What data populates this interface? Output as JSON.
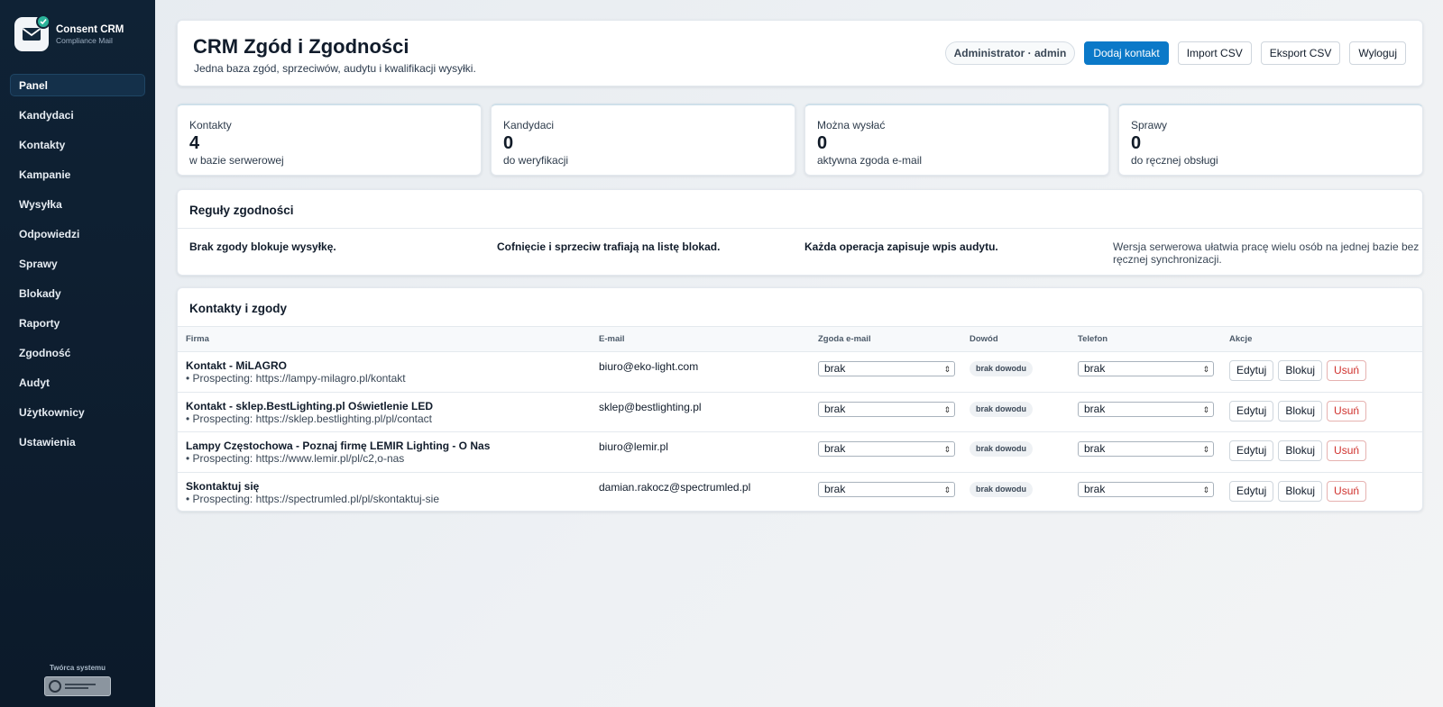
{
  "brand": {
    "title": "Consent CRM",
    "subtitle": "Compliance Mail"
  },
  "sidebar": {
    "items": [
      {
        "label": "Panel",
        "active": true
      },
      {
        "label": "Kandydaci"
      },
      {
        "label": "Kontakty"
      },
      {
        "label": "Kampanie"
      },
      {
        "label": "Wysyłka"
      },
      {
        "label": "Odpowiedzi"
      },
      {
        "label": "Sprawy"
      },
      {
        "label": "Blokady"
      },
      {
        "label": "Raporty"
      },
      {
        "label": "Zgodność"
      },
      {
        "label": "Audyt"
      },
      {
        "label": "Użytkownicy"
      },
      {
        "label": "Ustawienia"
      }
    ],
    "creator_label": "Twórca systemu"
  },
  "header": {
    "title": "CRM Zgód i Zgodności",
    "subtitle": "Jedna baza zgód, sprzeciwów, audytu i kwalifikacji wysyłki.",
    "user": "Administrator · admin",
    "add_contact": "Dodaj kontakt",
    "import_csv": "Import CSV",
    "export_csv": "Eksport CSV",
    "logout": "Wyloguj"
  },
  "stats": [
    {
      "label": "Kontakty",
      "value": "4",
      "desc": "w bazie serwerowej"
    },
    {
      "label": "Kandydaci",
      "value": "0",
      "desc": "do weryfikacji"
    },
    {
      "label": "Można wysłać",
      "value": "0",
      "desc": "aktywna zgoda e-mail"
    },
    {
      "label": "Sprawy",
      "value": "0",
      "desc": "do ręcznej obsługi"
    }
  ],
  "rules": {
    "title": "Reguły zgodności",
    "items": [
      "Brak zgody blokuje wysyłkę.",
      "Cofnięcie i sprzeciw trafiają na listę blokad.",
      "Każda operacja zapisuje wpis audytu.",
      "Wersja serwerowa ułatwia pracę wielu osób na jednej bazie bez ręcznej synchronizacji."
    ]
  },
  "contacts": {
    "title": "Kontakty i zgody",
    "columns": [
      "Firma",
      "E-mail",
      "Zgoda e-mail",
      "Dowód",
      "Telefon",
      "Akcje"
    ],
    "rows": [
      {
        "firm": "Kontakt - MiLAGRO",
        "source": "• Prospecting: https://lampy-milagro.pl/kontakt",
        "email": "biuro@eko-light.com",
        "consent": "brak",
        "proof": "brak dowodu",
        "phone": "brak"
      },
      {
        "firm": "Kontakt - sklep.BestLighting.pl Oświetlenie LED",
        "source": "• Prospecting: https://sklep.bestlighting.pl/pl/contact",
        "email": "sklep@bestlighting.pl",
        "consent": "brak",
        "proof": "brak dowodu",
        "phone": "brak"
      },
      {
        "firm": "Lampy Częstochowa - Poznaj firmę LEMIR Lighting - O Nas",
        "source": "• Prospecting: https://www.lemir.pl/pl/c2,o-nas",
        "email": "biuro@lemir.pl",
        "consent": "brak",
        "proof": "brak dowodu",
        "phone": "brak"
      },
      {
        "firm": "Skontaktuj się",
        "source": "• Prospecting: https://spectrumled.pl/pl/skontaktuj-sie",
        "email": "damian.rakocz@spectrumled.pl",
        "consent": "brak",
        "proof": "brak dowodu",
        "phone": "brak"
      }
    ],
    "actions": {
      "edit": "Edytuj",
      "block": "Blokuj",
      "delete": "Usuń"
    }
  },
  "colors": {
    "primary": "#0b79c8",
    "sidebar": "#0f2235",
    "danger": "#d0302c",
    "accent": "#2bb39a"
  }
}
